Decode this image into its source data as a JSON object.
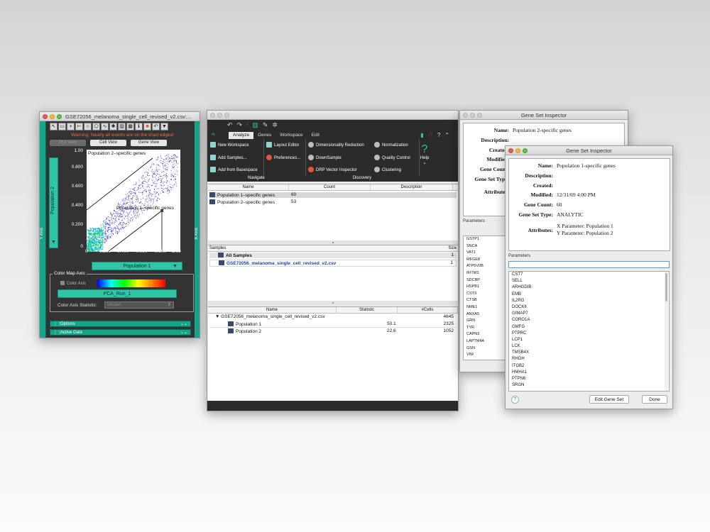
{
  "plot_window": {
    "title": "GSE72056_melanoma_single_cell_revised_v2.csv:...",
    "warning": "Warning: Nearly all events are on the chart edges!",
    "tabs": [
      "Plot View",
      "Cell View",
      "Gene View"
    ],
    "y_axis_label": "Population 2",
    "x_axis_label": "Population 1",
    "side_rail_left": "Y Axis",
    "side_rail_right": "X Axis",
    "y_ticks": [
      "1.00",
      "0.800",
      "0.600",
      "0.400",
      "0.200",
      "0"
    ],
    "x_ticks": [
      "0",
      "0.200",
      "0.400",
      "0.600",
      "0.800",
      "1.00"
    ],
    "annotation_pop2": "Population 2–specific genes",
    "annotation_pop1": "Population 1–specific genes",
    "color_map_title": "Color Map Axis",
    "color_axis_checkbox": "Color Axis",
    "color_axis_param": "PCA_Run_1",
    "color_axis_stat_label": "Color Axis Statistic:",
    "color_axis_stat_value": "Median",
    "options_label": "Options",
    "active_gate_label": "Active Gate"
  },
  "main_window": {
    "tabs": [
      "Analyze",
      "Genes",
      "Workspace",
      "Edit"
    ],
    "navigate": {
      "caption": "Navigate",
      "items": [
        "New Workspace",
        "Add Samples...",
        "Add from Basespace",
        "Layout Editor",
        "Preferences..."
      ]
    },
    "discovery": {
      "caption": "Discovery",
      "items": [
        "Dimensionality Reduction",
        "DownSample",
        "DRP Vector Inspector",
        "Normalization",
        "Quality Control",
        "Clustering"
      ]
    },
    "help_label": "Help",
    "gene_set_table": {
      "headers": [
        "Name",
        "Count",
        "Description"
      ],
      "rows": [
        {
          "name": "Population 1–specific genes",
          "count": "60"
        },
        {
          "name": "Population 2–specific genes",
          "count": "53"
        }
      ]
    },
    "samples_table": {
      "header_left": "Samples",
      "header_right": "Size",
      "rows": [
        {
          "name": "All Samples",
          "size": "1"
        },
        {
          "name": "GSE72056_melanoma_single_cell_revised_v2.csv",
          "size": "1"
        }
      ]
    },
    "populations_table": {
      "headers": [
        "Name",
        "Statistic",
        "#Cells"
      ],
      "rows": [
        {
          "name": "GSE72056_melanoma_single_cell_revised_v2.csv",
          "stat": "",
          "cells": "4645"
        },
        {
          "name": "Population 1",
          "stat": "50.1",
          "cells": "2325"
        },
        {
          "name": "Population 2",
          "stat": "22.6",
          "cells": "1052"
        }
      ]
    }
  },
  "inspector_back": {
    "title": "Gene Set Inspector",
    "fields": {
      "name_label": "Name:",
      "name_value": "Population 2-specific genes",
      "desc_label": "Description:",
      "created_label": "Created:",
      "modified_label": "Modified:",
      "count_label": "Gene Count:",
      "type_label": "Gene Set Type:",
      "attr_label": "Attributes:"
    },
    "parameters_label": "Parameters",
    "genes": [
      "GSTP1",
      "SNCA",
      "VAT1",
      "MFGE8",
      "ATP6V0B",
      "IFITM3",
      "SDCBP",
      "HSPB1",
      "CST3",
      "CTSB",
      "NME1",
      "ANXA5",
      "GRN",
      "TYR",
      "CAPN3",
      "LAPTM4A",
      "GSN",
      "VIM"
    ]
  },
  "inspector_front": {
    "title": "Gene Set Inspector",
    "fields": {
      "name_label": "Name:",
      "name_value": "Population 1-specific genes",
      "desc_label": "Description:",
      "created_label": "Created:",
      "modified_label": "Modified:",
      "modified_value": "12/31/69 4:00 PM",
      "count_label": "Gene Count:",
      "count_value": "60",
      "type_label": "Gene Set Type:",
      "type_value": "ANALYTIC",
      "attr_label": "Attributes:",
      "attr_value1": "X Parameter: Population 1",
      "attr_value2": "Y Parameter: Population 2"
    },
    "parameters_label": "Parameters",
    "genes": [
      "CST7",
      "SELL",
      "ARHGDIB",
      "EMB",
      "IL2RG",
      "DOCK8",
      "GIMAP7",
      "CORO1A",
      "GMFG",
      "PTPRC",
      "LCP1",
      "LCK",
      "TMSB4X",
      "RHOH",
      "ITGB2",
      "HMHA1",
      "PTPN6",
      "SRGN"
    ],
    "edit_button": "Edit Gene Set",
    "done_button": "Done",
    "help_button": "?"
  }
}
